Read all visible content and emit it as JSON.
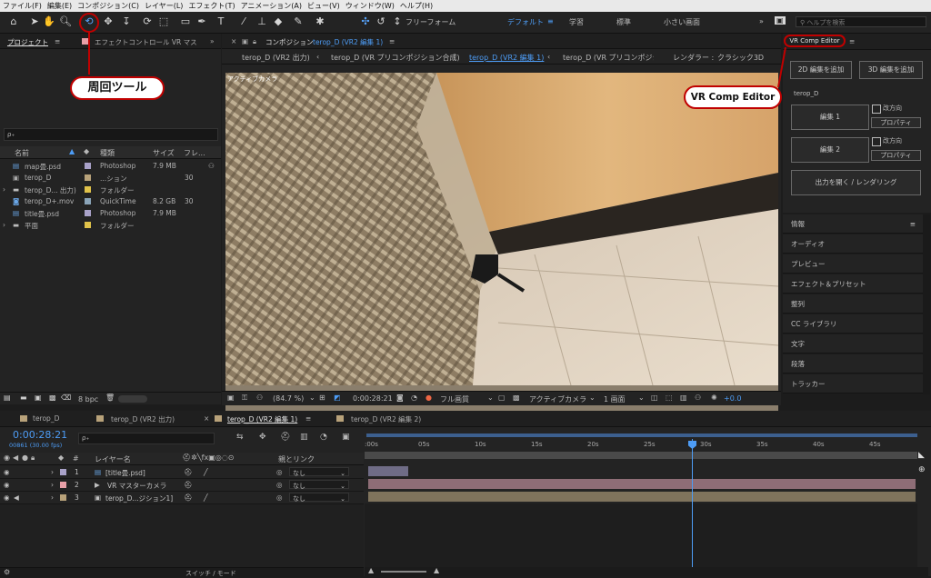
{
  "menu": [
    "ファイル(F)",
    "編集(E)",
    "コンポジション(C)",
    "レイヤー(L)",
    "エフェクト(T)",
    "アニメーション(A)",
    "ビュー(V)",
    "ウィンドウ(W)",
    "ヘルプ(H)"
  ],
  "toolbar": {
    "freeform_label": "フリーフォーム",
    "workspaces": [
      "デフォルト",
      "学習",
      "標準",
      "小さい画面"
    ],
    "search_placeholder": "ヘルプを検索"
  },
  "project": {
    "tab_project": "プロジェクト",
    "tab_effects": "エフェクトコントロール VR マスラ",
    "search_glyph": "ρ₊",
    "columns": [
      "名前",
      "種類",
      "サイズ",
      "フレ..."
    ],
    "items": [
      {
        "name": "map畳.psd",
        "type": "Photoshop",
        "size": "7.9 MB",
        "fr": "",
        "color": "#a9a2c9"
      },
      {
        "name": "terop_D",
        "type": "...ション",
        "size": "",
        "fr": "30",
        "color": "#b8a27a"
      },
      {
        "name": "terop_D... 出力)",
        "type": "フォルダー",
        "size": "",
        "fr": "",
        "color": "#e0c24a"
      },
      {
        "name": "terop_D+.mov",
        "type": "QuickTime",
        "size": "8.2 GB",
        "fr": "30",
        "color": "#8aa4b8"
      },
      {
        "name": "title畳.psd",
        "type": "Photoshop",
        "size": "7.9 MB",
        "fr": "",
        "color": "#a9a2c9"
      },
      {
        "name": "平面",
        "type": "フォルダー",
        "size": "",
        "fr": "",
        "color": "#e0c24a"
      }
    ],
    "bpc": "8 bpc"
  },
  "comp": {
    "tab_label": "コンポジション",
    "tab_name": "terop_D (VR2 編集 1)",
    "nav": [
      "terop_D (VR2 出力)",
      "terop_D (VR プリコンポジション合成)",
      "terop_D (VR2 編集 1)",
      "terop_D (VR プリコンポジショ1"
    ],
    "renderer_label": "レンダラー :",
    "renderer_value": "クラシック3D",
    "active_camera": "アクティブカメラ",
    "zoom": "(84.7 %)",
    "timecode": "0:00:28:21",
    "quality": "フル画質",
    "view_camera": "アクティブカメラ",
    "views": "1 画面",
    "exposure": "+0.0"
  },
  "vr_panel": {
    "title": "VR Comp Editor",
    "add_2d": "2D 編集を追加",
    "add_3d": "3D 編集を追加",
    "group": "terop_D",
    "edit1": "編集 1",
    "edit2": "編集 2",
    "reverse": "改方向",
    "properties": "プロパティ",
    "open_output": "出力を開く / レンダリング"
  },
  "right_panels": [
    "情報",
    "オーディオ",
    "プレビュー",
    "エフェクト＆プリセット",
    "整列",
    "CC ライブラリ",
    "文字",
    "段落",
    "トラッカー"
  ],
  "timeline": {
    "tabs": [
      "terop_D",
      "terop_D (VR2 出力)",
      "terop_D (VR2 編集 1)",
      "terop_D (VR2 編集 2)"
    ],
    "timecode": "0:00:28:21",
    "frames": "00861 (30.00 fps)",
    "col_layer": "レイヤー名",
    "col_parent": "親とリンク",
    "ruler": [
      ":00s",
      "05s",
      "10s",
      "15s",
      "20s",
      "25s",
      "30s",
      "35s",
      "40s",
      "45s"
    ],
    "playhead_seconds": 28.7,
    "layers": [
      {
        "num": "1",
        "name": "[title畳.psd]",
        "parent": "なし",
        "color": "#a9a2c9"
      },
      {
        "num": "2",
        "name": "VR マスターカメラ",
        "parent": "なし",
        "color": "#e8a0a8"
      },
      {
        "num": "3",
        "name": "terop_D...ジション1]",
        "parent": "なし",
        "color": "#b8a27a"
      }
    ],
    "switch_mode": "スイッチ / モード"
  },
  "callouts": {
    "rotate_tool": "周回ツール",
    "vr_comp_editor": "VR Comp Editor"
  }
}
